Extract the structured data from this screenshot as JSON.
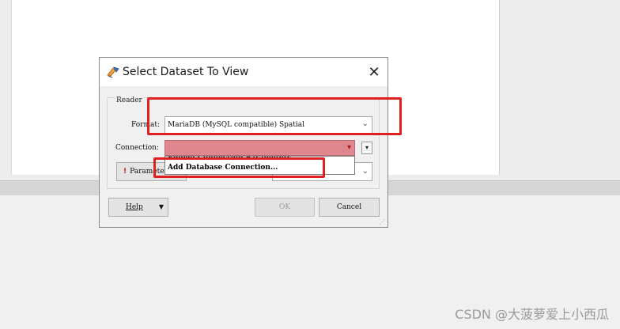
{
  "dialog": {
    "title": "Select Dataset To View",
    "close_glyph": "✕",
    "group_label": "Reader",
    "format_label": "Format:",
    "format_value": "MariaDB (MySQL compatible) Spatial",
    "connection_label": "Connection:",
    "connection_value": "",
    "parameters_label": "Parameters...",
    "dropdown_items": [
      "Embed Connection Parameters",
      "Add Database Connection..."
    ],
    "help_label": "Help",
    "ok_label": "OK",
    "cancel_label": "Cancel"
  },
  "watermark": "CSDN @大菠萝爱上小西瓜",
  "colors": {
    "highlight": "#e02020",
    "connection_invalid": "#e0868f"
  },
  "icons": [
    "app-icon",
    "close-icon",
    "chevron-down-icon",
    "warning-icon",
    "resize-grip-icon"
  ]
}
